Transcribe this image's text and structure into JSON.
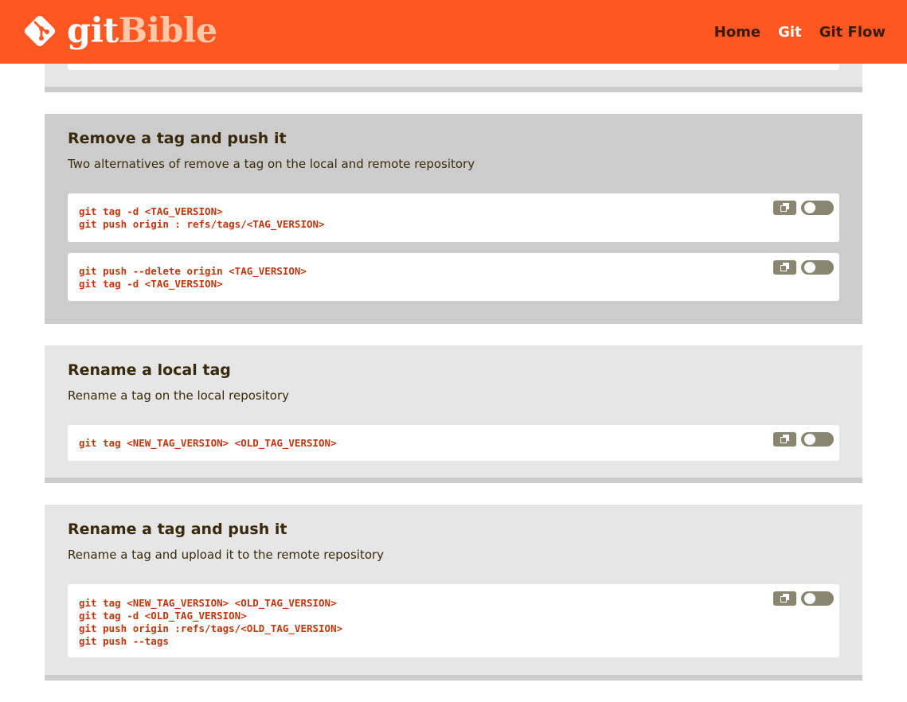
{
  "header": {
    "logo_git": "git",
    "logo_bible": "Bible",
    "nav": [
      {
        "label": "Home"
      },
      {
        "label": "Git"
      },
      {
        "label": "Git Flow"
      }
    ]
  },
  "sections": [
    {
      "title": "Remove a tag and push it",
      "description": "Two alternatives of remove a tag on the local and remote repository",
      "blocks": [
        {
          "lines": [
            "git tag -d <TAG_VERSION>",
            "git push origin : refs/tags/<TAG_VERSION>"
          ]
        },
        {
          "lines": [
            "git push --delete origin <TAG_VERSION>",
            "git tag -d <TAG_VERSION>"
          ]
        }
      ]
    },
    {
      "title": "Rename a local tag",
      "description": "Rename a tag on the local repository",
      "blocks": [
        {
          "lines": [
            "git tag <NEW_TAG_VERSION> <OLD_TAG_VERSION>"
          ]
        }
      ]
    },
    {
      "title": "Rename a tag and push it",
      "description": "Rename a tag and upload it to the remote repository",
      "blocks": [
        {
          "lines": [
            "git tag <NEW_TAG_VERSION> <OLD_TAG_VERSION>",
            "git tag -d <OLD_TAG_VERSION>",
            "git push origin :refs/tags/<OLD_TAG_VERSION>",
            "git push --tags"
          ]
        }
      ]
    }
  ],
  "colors": {
    "header_bg": "#ff5722",
    "code_text": "#c0370e",
    "button_bg": "#8a8570"
  }
}
